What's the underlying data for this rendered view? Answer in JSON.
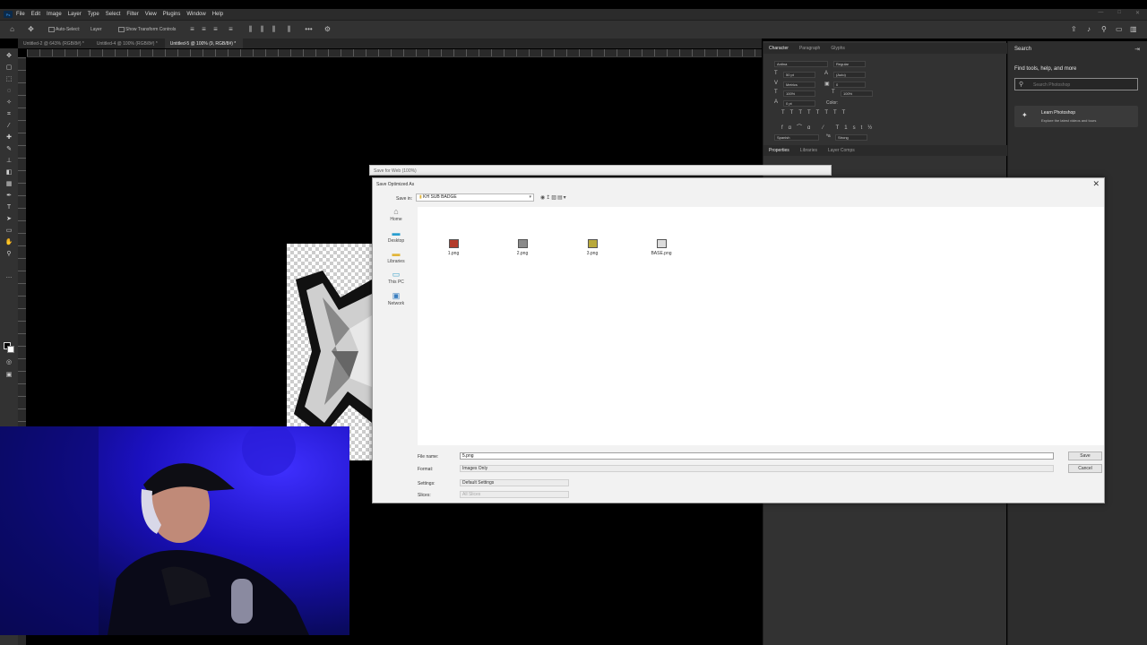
{
  "app": {
    "menu": [
      "File",
      "Edit",
      "Image",
      "Layer",
      "Type",
      "Select",
      "Filter",
      "View",
      "Plugins",
      "Window",
      "Help"
    ]
  },
  "options_bar": {
    "auto_select_label": "Auto-Select:",
    "auto_select_value": "Layer",
    "show_transform_label": "Show Transform Controls"
  },
  "document_tabs": [
    "Untitled-2 @ 643% (RGB/8#) *",
    "Untitled-4 @ 100% (RGB/8#) *",
    "Untitled-5 @ 100% (9, RGB/8#) *"
  ],
  "character_panel": {
    "tabs": [
      "Character",
      "Paragraph",
      "Glyphs"
    ],
    "font_family": "Antina",
    "font_style": "Regular",
    "font_size": "50 pt",
    "leading": "(Auto)",
    "kerning": "Metrics",
    "tracking": "0",
    "vertical_scale": "100%",
    "horizontal_scale": "100%",
    "baseline_shift": "0 pt",
    "color_label": "Color:",
    "language": "Spanish",
    "antialias": "Strong"
  },
  "properties_panel": {
    "tabs": [
      "Properties",
      "Libraries",
      "Layer Comps"
    ]
  },
  "search_panel": {
    "title": "Search",
    "heading": "Find tools, help, and more",
    "placeholder": "Search Photoshop",
    "learn_title": "Learn Photoshop",
    "learn_subtitle": "Explore the latest videos and tours"
  },
  "save_for_web": {
    "title": "Save for Web (100%)"
  },
  "save_dialog": {
    "title": "Save Optimized As",
    "save_in_label": "Save in:",
    "save_in_value": "KH SUB BADGE",
    "places": [
      "Home",
      "Desktop",
      "Libraries",
      "This PC",
      "Network"
    ],
    "files": [
      "1.png",
      "2.png",
      "3.png",
      "BASE.png"
    ],
    "file_name_label": "File name:",
    "file_name_value": "5.png",
    "format_label": "Format:",
    "format_value": "Images Only",
    "settings_label": "Settings:",
    "settings_value": "Default Settings",
    "slices_label": "Slices:",
    "slices_value": "All Slices",
    "save_button": "Save",
    "cancel_button": "Cancel"
  }
}
